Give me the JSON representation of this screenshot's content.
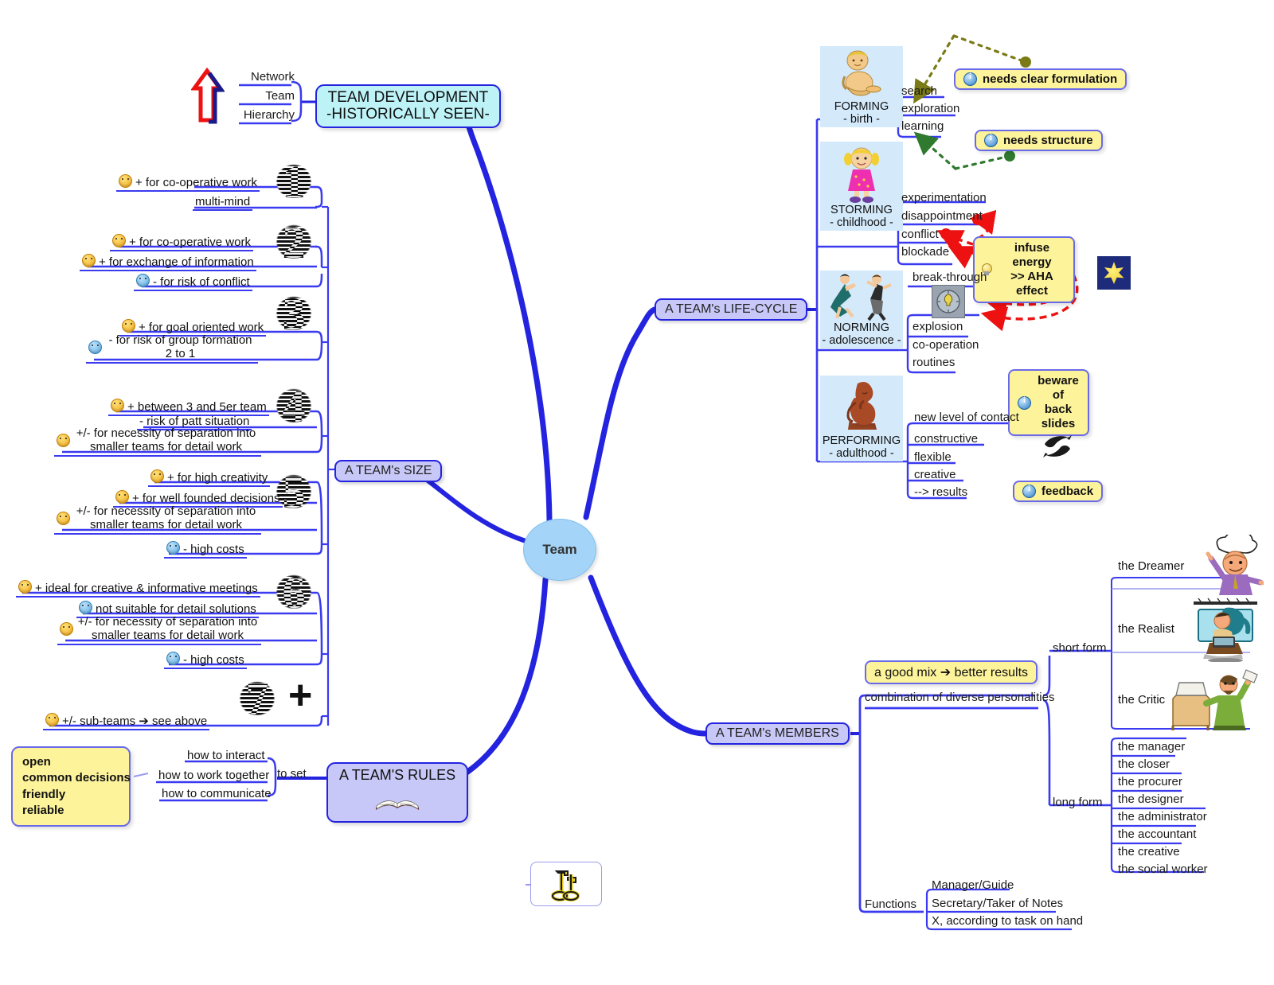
{
  "root": {
    "label": "Team"
  },
  "branches": {
    "development": {
      "label": "TEAM DEVELOPMENT\n-HISTORICALLY SEEN-",
      "line1": "TEAM DEVELOPMENT",
      "line2": "-HISTORICALLY SEEN-",
      "items": [
        "Network",
        "Team",
        "Hierarchy"
      ],
      "icon": "red-up-arrow-icon"
    },
    "size": {
      "label": "A TEAM's SIZE",
      "groups": [
        {
          "number": "1",
          "items": [
            {
              "smiley": "yellow",
              "text": "+ for co-operative work"
            },
            {
              "smiley": "none",
              "text": "multi-mind"
            }
          ]
        },
        {
          "number": "2",
          "items": [
            {
              "smiley": "yellow",
              "text": "+ for co-operative work"
            },
            {
              "smiley": "yellow",
              "text": "+ for exchange of information"
            },
            {
              "smiley": "blue",
              "text": "- for risk of conflict"
            }
          ]
        },
        {
          "number": "3",
          "items": [
            {
              "smiley": "yellow",
              "text": "+ for goal oriented work"
            },
            {
              "smiley": "blue",
              "text": "- for risk of group formation 2 to 1"
            }
          ]
        },
        {
          "number": "4",
          "items": [
            {
              "smiley": "yellow",
              "text": "+ between 3 and 5er team"
            },
            {
              "smiley": "none",
              "text": "- risk of patt situation"
            },
            {
              "smiley": "yellow",
              "text": "+/- for necessity of separation into smaller teams for detail work"
            }
          ]
        },
        {
          "number": "5",
          "items": [
            {
              "smiley": "yellow",
              "text": "+ for high creativity"
            },
            {
              "smiley": "yellow",
              "text": "+ for well founded decisions"
            },
            {
              "smiley": "yellow",
              "text": "+/- for necessity of separation into smaller teams for detail work"
            },
            {
              "smiley": "blue",
              "text": "- high costs"
            }
          ]
        },
        {
          "number": "6",
          "items": [
            {
              "smiley": "yellow",
              "text": "+ ideal for creative & informative meetings"
            },
            {
              "smiley": "blue",
              "text": "not suitable for detail solutions"
            },
            {
              "smiley": "yellow",
              "text": "+/- for necessity of separation into smaller teams for detail work"
            },
            {
              "smiley": "blue",
              "text": "- high costs"
            }
          ]
        },
        {
          "number": "7",
          "suffix": "+",
          "items": [
            {
              "smiley": "yellow",
              "text": "+/- sub-teams ➔ see above"
            }
          ]
        }
      ]
    },
    "rules": {
      "label": "A TEAM'S RULES",
      "connector": "to set",
      "items": [
        "how to interact",
        "how to work together",
        "how to communicate"
      ],
      "callout": "open\ncommon decisions\nfriendly\nreliable",
      "callout_lines": [
        "open",
        "common decisions",
        "friendly",
        "reliable"
      ],
      "icon": "open-book-icon"
    },
    "lifecycle": {
      "label": "A TEAM's LIFE-CYCLE",
      "stages": [
        {
          "name": "FORMING",
          "sub": "- birth -",
          "art": "baby-icon",
          "items": [
            "search",
            "exploration",
            "learning"
          ],
          "callouts": [
            {
              "text": "needs clear formulation",
              "icon": "info-icon"
            },
            {
              "text": "needs structure",
              "icon": "info-icon"
            }
          ]
        },
        {
          "name": "STORMING",
          "sub": "- childhood -",
          "art": "girl-icon",
          "items": [
            "experimentation",
            "disappointment",
            "conflict",
            "blockade"
          ],
          "callouts": [
            {
              "text": "infuse energy\n>> AHA effect",
              "line1": "infuse energy",
              "line2": ">> AHA effect",
              "icon": "bulb-icon"
            }
          ]
        },
        {
          "name": "NORMING",
          "sub": "- adolescence -",
          "art": "dancers-icon",
          "header": "break-through",
          "header_icon": "clock-bulb-icon",
          "items": [
            "explosion",
            "co-operation",
            "routines"
          ],
          "callouts": [
            {
              "text": "beware of back slides",
              "line1": "beware of",
              "line2": "back slides",
              "icon": "info-icon"
            }
          ]
        },
        {
          "name": "PERFORMING",
          "sub": "- adulthood -",
          "art": "thinker-icon",
          "items": [
            "new level of contact",
            "constructive",
            "flexible",
            "creative",
            "--> results"
          ],
          "callouts": [
            {
              "text": "feedback",
              "icon": "info-icon"
            }
          ]
        }
      ],
      "star_icon": "starburst-icon",
      "dolphin_icon": "dolphins-icon"
    },
    "members": {
      "label": "A TEAM's MEMBERS",
      "combination_label": "combination of diverse personalities",
      "combination_callout": "a good mix ➔ better results",
      "short_form_label": "short form",
      "short_form": [
        {
          "label": "the Dreamer",
          "art": "dreamer-icon"
        },
        {
          "label": "the Realist",
          "art": "realist-icon"
        },
        {
          "label": "the Critic",
          "art": "critic-icon"
        }
      ],
      "long_form_label": "long form",
      "long_form": [
        "the manager",
        "the closer",
        "the procurer",
        "the designer",
        "the administrator",
        "the accountant",
        "the creative",
        "the social worker"
      ],
      "functions_label": "Functions",
      "functions": [
        "Manager/Guide",
        "Secretary/Taker of Notes",
        "X, according to task on hand"
      ]
    }
  },
  "floating": {
    "keys_icon": "golden-keys-icon"
  },
  "colors": {
    "branch": "#2323e0",
    "leaf_underline": "#3a3af0",
    "pill_fill": "#c8c8f8",
    "title_fill": "#bdf2f7",
    "callout_fill": "#fdf39b",
    "stage_fill": "#d4eafb",
    "root_fill": "#a4d4f7",
    "accent_red": "#ee2222",
    "accent_olive": "#7a7a16"
  }
}
